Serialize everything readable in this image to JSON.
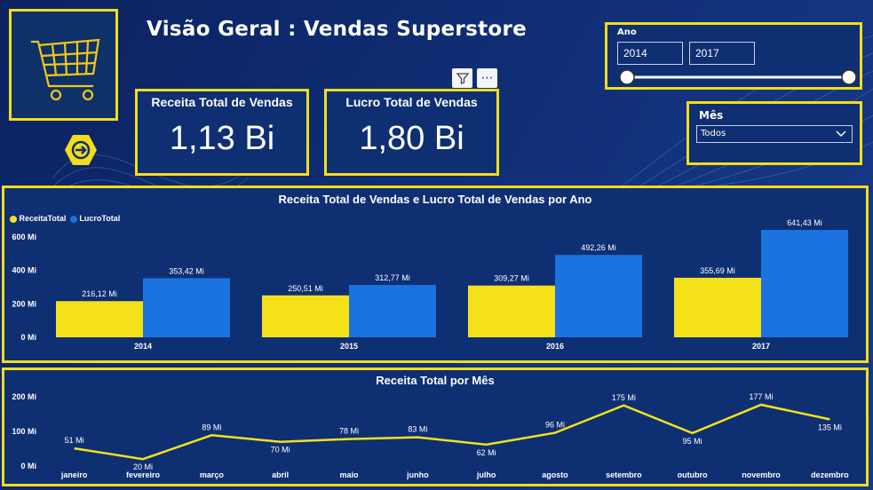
{
  "page": {
    "title": "Visão Geral :  Vendas Superstore"
  },
  "kpis": [
    {
      "label": "Receita Total de Vendas",
      "value": "1,13 Bi"
    },
    {
      "label": "Lucro Total de Vendas",
      "value": "1,80 Bi"
    }
  ],
  "visual_header": {
    "filter_icon": "filter-icon",
    "more_icon": "ellipsis-icon"
  },
  "year_slicer": {
    "label": "Ano",
    "start": "2014",
    "end": "2017",
    "range_fraction": [
      0,
      1
    ]
  },
  "month_slicer": {
    "label": "Mês",
    "selected": "Todos"
  },
  "colors": {
    "accent": "#f2dd1a",
    "receita": "#f5e11a",
    "lucro": "#1a73df",
    "panel": "#0f2f73"
  },
  "chart_data": [
    {
      "type": "bar",
      "title": "Receita Total de Vendas e Lucro Total de Vendas por Ano",
      "categories": [
        "2014",
        "2015",
        "2016",
        "2017"
      ],
      "series": [
        {
          "name": "ReceitaTotal",
          "values": [
            216.12,
            250.51,
            309.27,
            355.69
          ],
          "labels": [
            "216,12 Mi",
            "250,51 Mi",
            "309,27 Mi",
            "355,69 Mi"
          ]
        },
        {
          "name": "LucroTotal",
          "values": [
            353.42,
            312.77,
            492.26,
            641.43
          ],
          "labels": [
            "353,42 Mi",
            "312,77 Mi",
            "492,26 Mi",
            "641,43 Mi"
          ]
        }
      ],
      "yticks": [
        0,
        200,
        400,
        600
      ],
      "ytick_labels": [
        "0 Mi",
        "200 Mi",
        "400 Mi",
        "600 Mi"
      ],
      "ylim": [
        0,
        700
      ],
      "legend": "top-left",
      "grid": false
    },
    {
      "type": "line",
      "title": "Receita Total por Mês",
      "categories": [
        "janeiro",
        "fevereiro",
        "março",
        "abril",
        "maio",
        "junho",
        "julho",
        "agosto",
        "setembro",
        "outubro",
        "novembro",
        "dezembro"
      ],
      "values": [
        51,
        20,
        89,
        70,
        78,
        83,
        62,
        96,
        175,
        95,
        177,
        135
      ],
      "labels": [
        "51 Mi",
        "20 Mi",
        "89 Mi",
        "70 Mi",
        "78 Mi",
        "83 Mi",
        "62 Mi",
        "96 Mi",
        "175 Mi",
        "95 Mi",
        "177 Mi",
        "135 Mi"
      ],
      "yticks": [
        0,
        100,
        200
      ],
      "ytick_labels": [
        "0 Mi",
        "100 Mi",
        "200 Mi"
      ],
      "ylim": [
        0,
        200
      ],
      "grid": false
    }
  ]
}
